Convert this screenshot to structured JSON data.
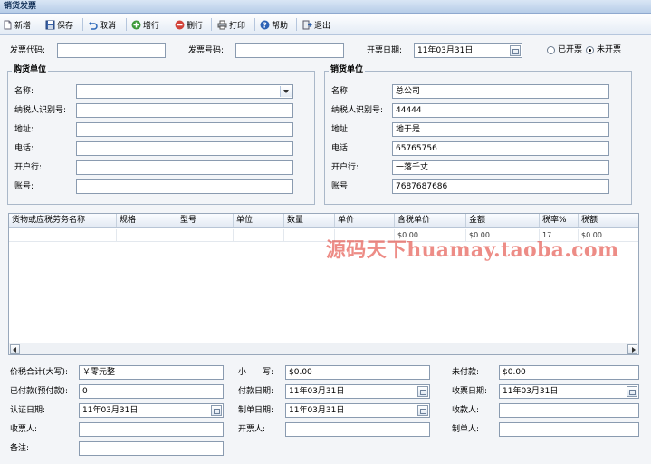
{
  "window": {
    "title": "销货发票"
  },
  "toolbar": {
    "buttons": [
      {
        "label": "新增",
        "icon": "new-icon"
      },
      {
        "label": "保存",
        "icon": "save-icon"
      },
      {
        "label": "取消",
        "icon": "undo-icon"
      },
      {
        "label": "增行",
        "icon": "add-row-icon"
      },
      {
        "label": "删行",
        "icon": "delete-row-icon"
      },
      {
        "label": "打印",
        "icon": "print-icon"
      },
      {
        "label": "帮助",
        "icon": "help-icon"
      },
      {
        "label": "退出",
        "icon": "exit-icon"
      }
    ]
  },
  "header": {
    "invoice_code_label": "发票代码:",
    "invoice_code": "",
    "invoice_no_label": "发票号码:",
    "invoice_no": "",
    "invoice_date_label": "开票日期:",
    "invoice_date": "11年03月31日",
    "issued_label": "已开票",
    "not_issued_label": "未开票",
    "selected_status": "未开票"
  },
  "buyer": {
    "legend": "购货单位",
    "name_label": "名称:",
    "name": "",
    "taxid_label": "纳税人识别号:",
    "taxid": "",
    "address_label": "地址:",
    "address": "",
    "phone_label": "电话:",
    "phone": "",
    "bank_label": "开户行:",
    "bank": "",
    "account_label": "账号:",
    "account": ""
  },
  "seller": {
    "legend": "销货单位",
    "name_label": "名称:",
    "name": "总公司",
    "taxid_label": "纳税人识别号:",
    "taxid": "44444",
    "address_label": "地址:",
    "address": "地于是",
    "phone_label": "电话:",
    "phone": "65765756",
    "bank_label": "开户行:",
    "bank": "一落千丈",
    "account_label": "账号:",
    "account": "7687687686"
  },
  "grid": {
    "columns": [
      "货物或应税劳务名称",
      "规格",
      "型号",
      "单位",
      "数量",
      "单价",
      "含税单价",
      "金额",
      "税率%",
      "税额"
    ],
    "rows": [
      [
        "",
        "",
        "",
        "",
        "",
        "",
        "$0.00",
        "$0.00",
        "17",
        "$0.00"
      ]
    ]
  },
  "footer": {
    "total_upper_label": "价税合计(大写):",
    "total_upper": "￥零元整",
    "subtotal_label": "小　　写:",
    "subtotal": "$0.00",
    "unpaid_label": "未付款:",
    "unpaid": "$0.00",
    "paid_label": "已付款(预付款):",
    "paid": "0",
    "pay_date_label": "付款日期:",
    "pay_date": "11年03月31日",
    "receive_date_label": "收票日期:",
    "receive_date": "11年03月31日",
    "verify_date_label": "认证日期:",
    "verify_date": "11年03月31日",
    "make_date_label": "制单日期:",
    "make_date": "11年03月31日",
    "collector_label": "收款人:",
    "collector": "",
    "biller_label": "开票人:",
    "biller": "",
    "maker_label": "制单人:",
    "maker": "",
    "ticket_receiver_label": "收票人:",
    "ticket_receiver": "",
    "remark_label": "备注:",
    "remark": ""
  },
  "watermark": "源码天下huamay.taoba.com"
}
